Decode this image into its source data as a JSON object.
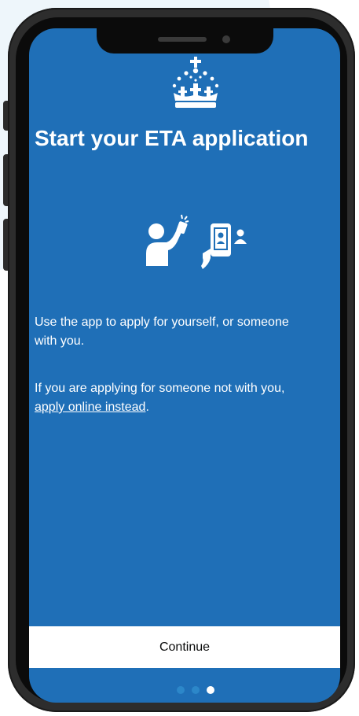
{
  "screen": {
    "title": "Start your ETA application",
    "paragraph1": "Use the app to apply for yourself, or someone\nwith you.",
    "paragraph2_prefix": "If you are applying for someone not with you,\n",
    "paragraph2_link": "apply online instead",
    "paragraph2_suffix": ".",
    "continue_label": "Continue",
    "pagination": {
      "total": 3,
      "current": 3
    }
  },
  "colors": {
    "screen_background": "#1f6fb7",
    "text": "#ffffff",
    "button_background": "#ffffff",
    "inactive_dot": "#2c87c9"
  },
  "icons": [
    "crown-icon",
    "selfie-person-icon",
    "phone-id-icon"
  ]
}
